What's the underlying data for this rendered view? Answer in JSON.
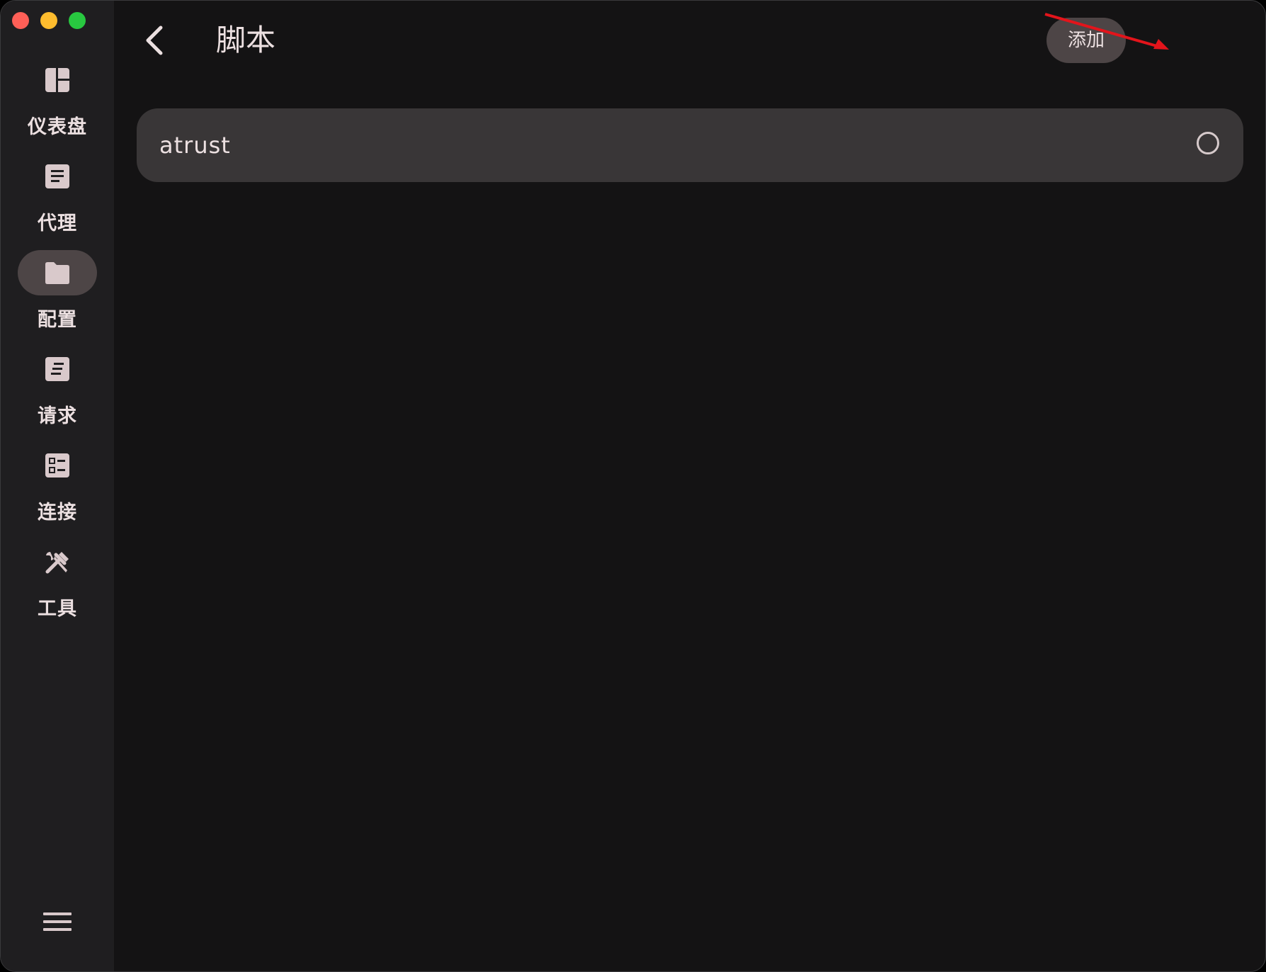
{
  "window": {
    "controls": [
      {
        "name": "close",
        "color": "#fe5f57"
      },
      {
        "name": "minimize",
        "color": "#febc2e"
      },
      {
        "name": "zoom",
        "color": "#28c840"
      }
    ]
  },
  "sidebar": {
    "items": [
      {
        "label": "仪表盘",
        "icon": "dashboard-icon",
        "active": false
      },
      {
        "label": "代理",
        "icon": "proxy-list-icon",
        "active": false
      },
      {
        "label": "配置",
        "icon": "folder-icon",
        "active": true
      },
      {
        "label": "请求",
        "icon": "request-icon",
        "active": false
      },
      {
        "label": "连接",
        "icon": "connection-icon",
        "active": false
      },
      {
        "label": "工具",
        "icon": "tools-icon",
        "active": false
      }
    ],
    "menu_icon": "hamburger-menu-icon"
  },
  "header": {
    "title": "脚本",
    "add_label": "添加"
  },
  "scripts": [
    {
      "name": "atrust",
      "selected": false
    }
  ],
  "colors": {
    "background": "#141314",
    "sidebar": "#1f1e20",
    "card": "#393637",
    "pill": "#4d4546",
    "text": "#ece0e1",
    "annotation": "#e3141b"
  }
}
